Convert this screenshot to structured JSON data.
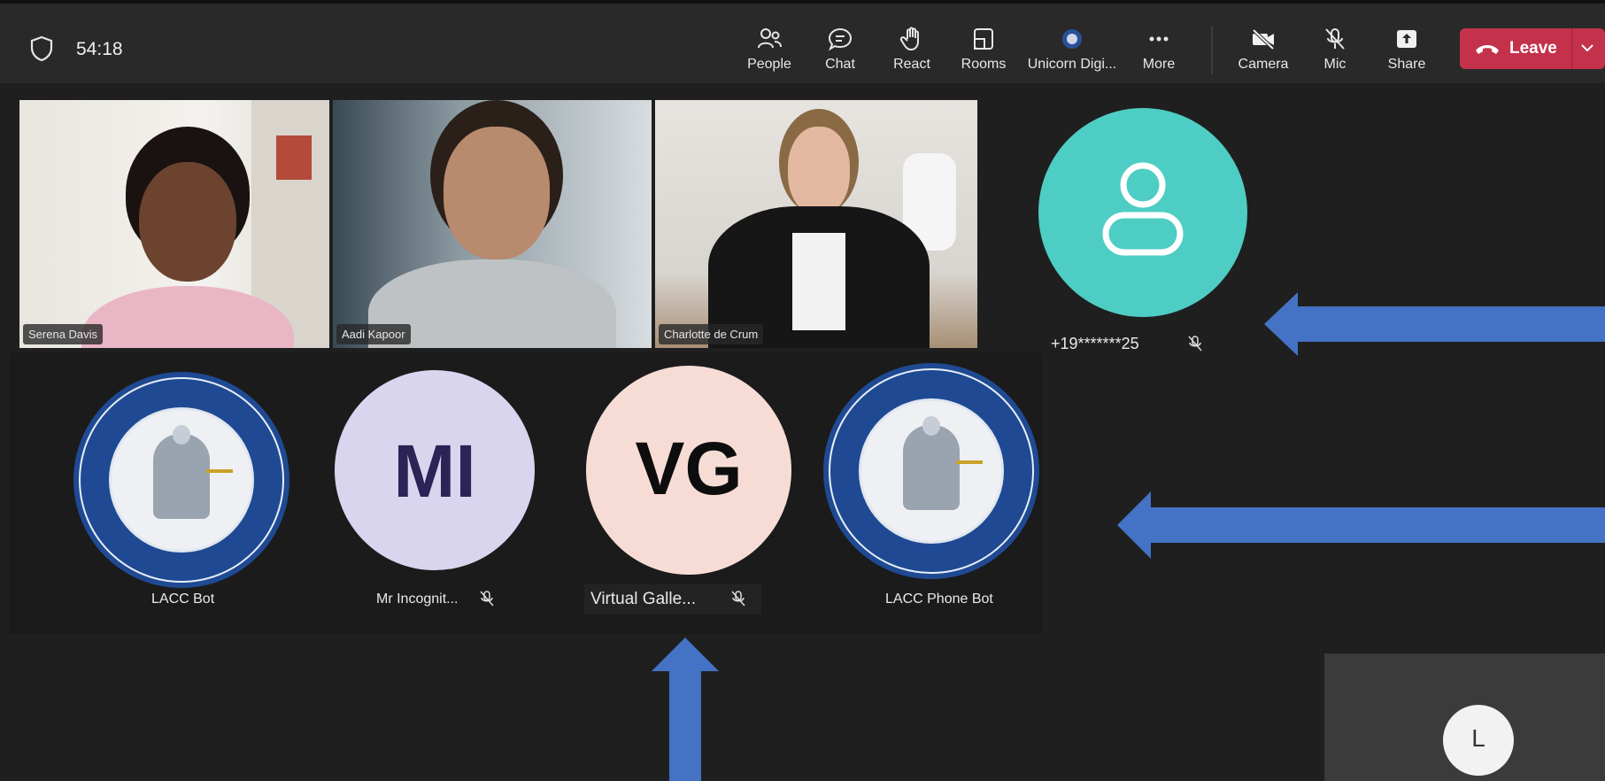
{
  "meeting": {
    "timer": "54:18"
  },
  "toolbar": {
    "people_label": "People",
    "chat_label": "Chat",
    "react_label": "React",
    "rooms_label": "Rooms",
    "app_label": "Unicorn Digi...",
    "more_label": "More",
    "camera_label": "Camera",
    "mic_label": "Mic",
    "share_label": "Share",
    "leave_label": "Leave"
  },
  "video_tiles": [
    {
      "name": "Serena Davis"
    },
    {
      "name": "Aadi Kapoor"
    },
    {
      "name": "Charlotte de Crum"
    }
  ],
  "phone_caller": {
    "number": "+19*******25"
  },
  "participants": [
    {
      "name": "LACC Bot"
    },
    {
      "name": "Mr Incognit...",
      "initials": "MI"
    },
    {
      "name": "Virtual  Galle...",
      "initials": "VG"
    },
    {
      "name": "LACC Phone Bot"
    }
  ],
  "self_view": {
    "initial": "L"
  },
  "colors": {
    "leave": "#c4314b",
    "phone_avatar": "#4ecdc4",
    "mi_avatar": "#d9d5ef",
    "vg_avatar": "#f7dcd6",
    "arrow": "#4472c4"
  }
}
